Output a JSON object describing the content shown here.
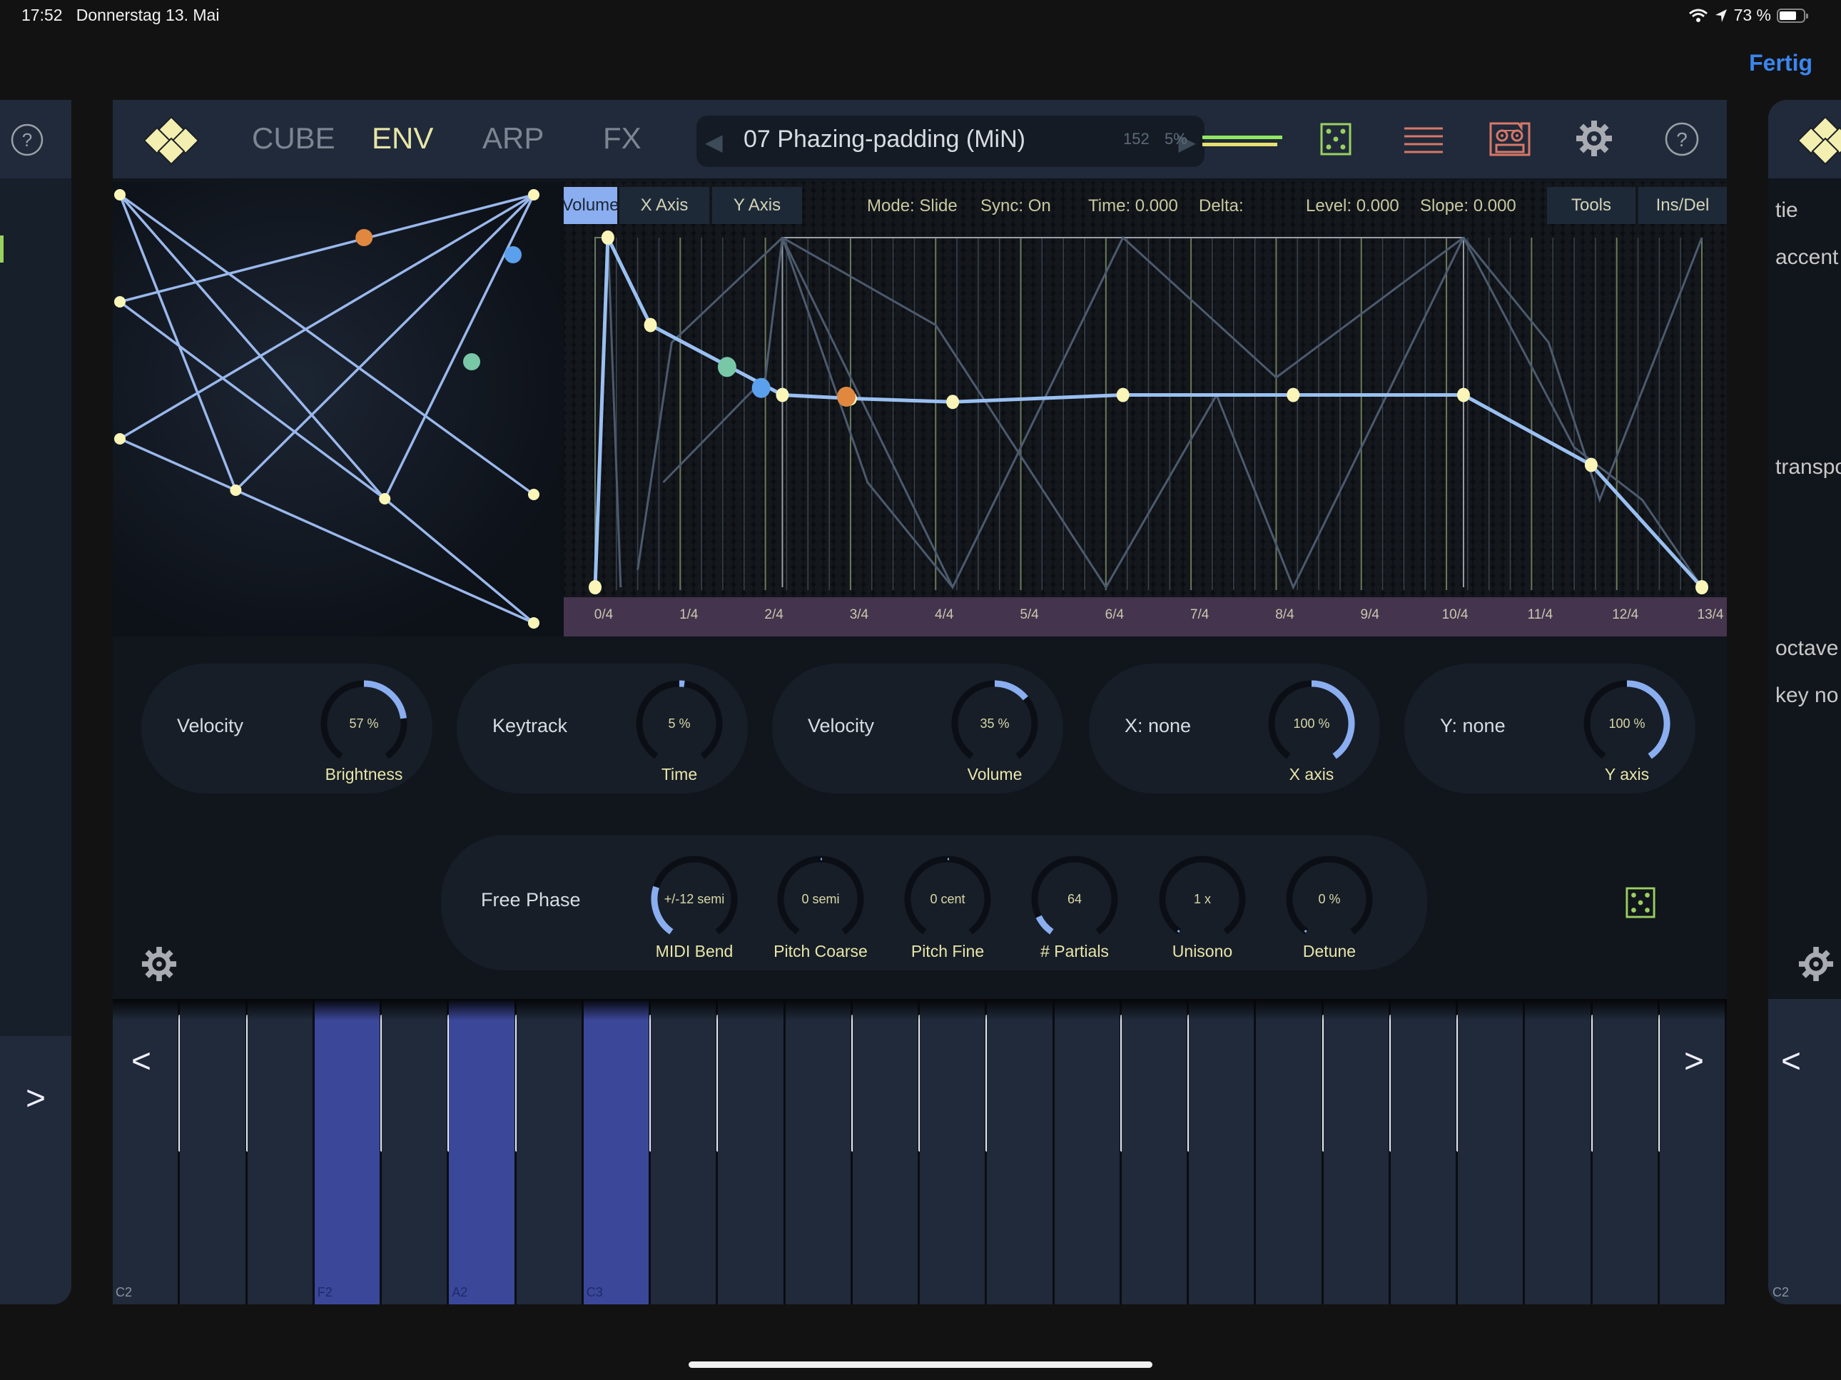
{
  "status_bar": {
    "time": "17:52",
    "date": "Donnerstag 13. Mai",
    "battery_text": "73 %",
    "battery_level": 0.73,
    "icons": [
      "wifi-icon",
      "location-arrow-icon",
      "battery-icon"
    ]
  },
  "nav": {
    "done_label": "Fertig"
  },
  "header": {
    "tabs": [
      {
        "label": "CUBE",
        "active": false
      },
      {
        "label": "ENV",
        "active": true
      },
      {
        "label": "ARP",
        "active": false
      },
      {
        "label": "FX",
        "active": false
      }
    ],
    "preset_name": "07 Phazing-padding (MiN)",
    "prev_arrow": "◀",
    "next_arrow": "▶",
    "cpu_value": "152",
    "cpu_percent": "5%",
    "icons": [
      "logo-icon",
      "dice-icon",
      "menu-lines-icon",
      "tape-recorder-icon",
      "gear-icon",
      "help-icon"
    ]
  },
  "envelope": {
    "tabs": [
      {
        "label": "Volume",
        "selected": true
      },
      {
        "label": "X Axis",
        "selected": false
      },
      {
        "label": "Y Axis",
        "selected": false
      }
    ],
    "mode": "Mode: Slide",
    "sync": "Sync: On",
    "time": "Time: 0.000",
    "delta": "Delta:",
    "level": "Level: 0.000",
    "slope": "Slope: 0.000",
    "tools_label": "Tools",
    "insdel_label": "Ins/Del",
    "beat_labels": [
      "0/4",
      "1/4",
      "2/4",
      "3/4",
      "4/4",
      "5/4",
      "6/4",
      "7/4",
      "8/4",
      "9/4",
      "10/4",
      "11/4",
      "12/4",
      "13/4"
    ],
    "beats_total": 13,
    "volume_points": [
      [
        0,
        0
      ],
      [
        0.15,
        1.0
      ],
      [
        0.65,
        0.75
      ],
      [
        2.2,
        0.55
      ],
      [
        3.0,
        0.54
      ],
      [
        4.2,
        0.53
      ],
      [
        6.2,
        0.55
      ],
      [
        8.2,
        0.55
      ],
      [
        10.2,
        0.55
      ],
      [
        11.7,
        0.35
      ],
      [
        13.0,
        0.0
      ]
    ],
    "markers": [
      {
        "t": 1.55,
        "level": 0.63,
        "color": "#78c8a8"
      },
      {
        "t": 1.95,
        "level": 0.57,
        "color": "#5aa0ec"
      },
      {
        "t": 2.95,
        "level": 0.545,
        "color": "#e08840"
      }
    ],
    "ghost_paths": [
      [
        [
          0.15,
          1.0
        ],
        [
          0.3,
          0.0
        ]
      ],
      [
        [
          0.5,
          0.05
        ],
        [
          0.9,
          0.7
        ],
        [
          2.2,
          1.0
        ]
      ],
      [
        [
          0.8,
          0.3
        ],
        [
          2.0,
          0.6
        ],
        [
          2.2,
          1.0
        ]
      ],
      [
        [
          2.2,
          1.0
        ],
        [
          4.0,
          0.75
        ],
        [
          6.0,
          0.0
        ],
        [
          7.3,
          0.55
        ],
        [
          8.2,
          0.0
        ],
        [
          10.2,
          1.0
        ]
      ],
      [
        [
          2.2,
          1.0
        ],
        [
          4.2,
          0.0
        ],
        [
          6.2,
          1.0
        ],
        [
          8.0,
          0.6
        ],
        [
          10.2,
          1.0
        ]
      ],
      [
        [
          2.2,
          1.0
        ],
        [
          3.2,
          0.3
        ],
        [
          4.2,
          0.0
        ]
      ],
      [
        [
          10.2,
          1.0
        ],
        [
          11.2,
          0.7
        ],
        [
          11.8,
          0.25
        ],
        [
          13.0,
          1.0
        ]
      ],
      [
        [
          10.2,
          1.0
        ],
        [
          11.5,
          0.4
        ],
        [
          12.3,
          0.25
        ],
        [
          13.0,
          0.0
        ]
      ]
    ]
  },
  "xy_pad": {
    "nodes": [
      [
        0,
        0
      ],
      [
        1,
        0
      ],
      [
        0,
        0.25
      ],
      [
        0,
        0.57
      ],
      [
        0.28,
        0.69
      ],
      [
        0.64,
        0.71
      ],
      [
        1,
        0.7
      ],
      [
        1,
        1
      ]
    ],
    "edges": [
      [
        0,
        4
      ],
      [
        0,
        5
      ],
      [
        0,
        6
      ],
      [
        2,
        1
      ],
      [
        2,
        5
      ],
      [
        3,
        1
      ],
      [
        3,
        4
      ],
      [
        4,
        1
      ],
      [
        4,
        7
      ],
      [
        5,
        1
      ],
      [
        5,
        7
      ]
    ],
    "markers": [
      {
        "x": 0.59,
        "y": 0.1,
        "color": "#e08840"
      },
      {
        "x": 0.95,
        "y": 0.14,
        "color": "#5aa0ec"
      },
      {
        "x": 0.85,
        "y": 0.39,
        "color": "#78c8a8"
      }
    ]
  },
  "mod_knobs": [
    {
      "source": "Velocity",
      "target": "Brightness",
      "value": "57",
      "unit": "%",
      "amount": 0.57,
      "bipolar": true
    },
    {
      "source": "Keytrack",
      "target": "Time",
      "value": "5",
      "unit": "%",
      "amount": 0.05,
      "bipolar": true
    },
    {
      "source": "Velocity",
      "target": "Volume",
      "value": "35",
      "unit": "%",
      "amount": 0.35,
      "bipolar": true
    },
    {
      "source": "X: none",
      "target": "X axis",
      "value": "100",
      "unit": "%",
      "amount": 1.0,
      "bipolar": true
    },
    {
      "source": "Y: none",
      "target": "Y axis",
      "value": "100",
      "unit": "%",
      "amount": 1.0,
      "bipolar": true
    }
  ],
  "osc_panel": {
    "label": "Free Phase",
    "knobs": [
      {
        "title": "MIDI Bend",
        "value": "+/-12 semi",
        "amount": 0.25,
        "bipolar": false
      },
      {
        "title": "Pitch Coarse",
        "value": "0 semi",
        "amount": 0.0,
        "bipolar": true
      },
      {
        "title": "Pitch Fine",
        "value": "0   cent",
        "amount": 0.0,
        "bipolar": true
      },
      {
        "title": "# Partials",
        "value": "64",
        "amount": 0.1,
        "bipolar": false
      },
      {
        "title": "Unisono",
        "value": "1 x",
        "amount": 0.0,
        "bipolar": false
      },
      {
        "title": "Detune",
        "value": "0   %",
        "amount": 0.0,
        "bipolar": false
      }
    ]
  },
  "keyboard": {
    "white_keys": [
      "C2",
      "D2",
      "E2",
      "F2",
      "G2",
      "A2",
      "B2",
      "C3",
      "D3",
      "E3",
      "F3",
      "G3",
      "A3",
      "B3",
      "C4",
      "D4",
      "E4",
      "F4",
      "G4",
      "A4",
      "B4",
      "C5",
      "D5",
      "E5"
    ],
    "active_keys": [
      "F2",
      "A2",
      "C3"
    ],
    "key_labels": {
      "C2": "C2",
      "F2": "F2",
      "A2": "A2",
      "C3": "C3"
    },
    "prev_label": "<",
    "next_label": ">"
  },
  "left_panel": {
    "next_label": ">"
  },
  "right_panel": {
    "labels": [
      "tie",
      "accent",
      "transpo",
      "octave",
      "key no"
    ],
    "prev_label": "<",
    "key_label": "C2"
  }
}
